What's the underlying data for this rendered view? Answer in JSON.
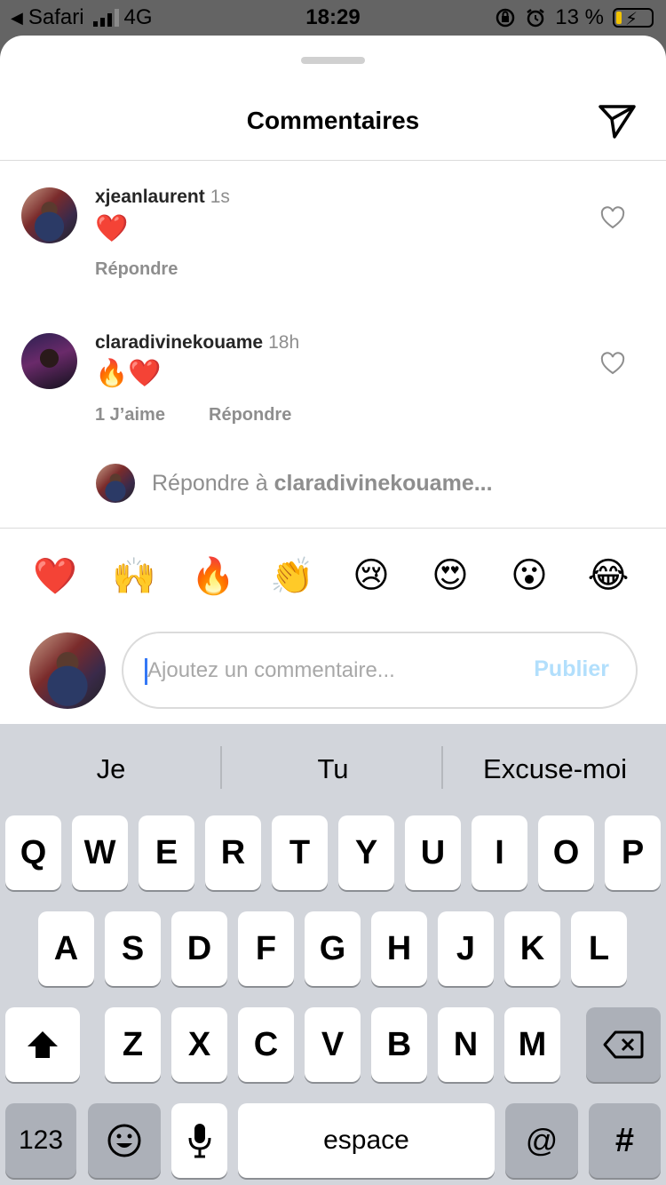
{
  "status_bar": {
    "carrier": "Safari",
    "network": "4G",
    "time": "18:29",
    "battery": "13 %",
    "back_glyph": "◀"
  },
  "sheet": {
    "title": "Commentaires"
  },
  "comments": [
    {
      "username": "xjeanlaurent",
      "time": "1s",
      "text": "❤️",
      "reply": "Répondre"
    },
    {
      "username": "claradivinekouame",
      "time": "18h",
      "text": "🔥❤️",
      "likes": "1 J’aime",
      "reply": "Répondre"
    }
  ],
  "reply_prompt": {
    "prefix": "Répondre à",
    "target": "claradivinekouame..."
  },
  "emoji_bar": [
    "❤️",
    "🙌",
    "🔥",
    "👏",
    "😢",
    "😍",
    "😮",
    "😂"
  ],
  "composer": {
    "placeholder": "Ajoutez un commentaire...",
    "value": "",
    "publish_label": "Publier"
  },
  "keyboard": {
    "predictions": [
      "Je",
      "Tu",
      "Excuse-moi"
    ],
    "row1": [
      "Q",
      "W",
      "E",
      "R",
      "T",
      "Y",
      "U",
      "I",
      "O",
      "P"
    ],
    "row2": [
      "A",
      "S",
      "D",
      "F",
      "G",
      "H",
      "J",
      "K",
      "L"
    ],
    "row3": [
      "Z",
      "X",
      "C",
      "V",
      "B",
      "N",
      "M"
    ],
    "numbers_key": "123",
    "emoji_key": "☺",
    "space_key": "espace",
    "at_key": "@",
    "hash_key": "#",
    "shift_glyph": "⬆",
    "delete_glyph": "⌫"
  },
  "colors": {
    "publish_disabled": "#b2dffc",
    "caret": "#3478f6",
    "battery_low": "#f2c300"
  }
}
